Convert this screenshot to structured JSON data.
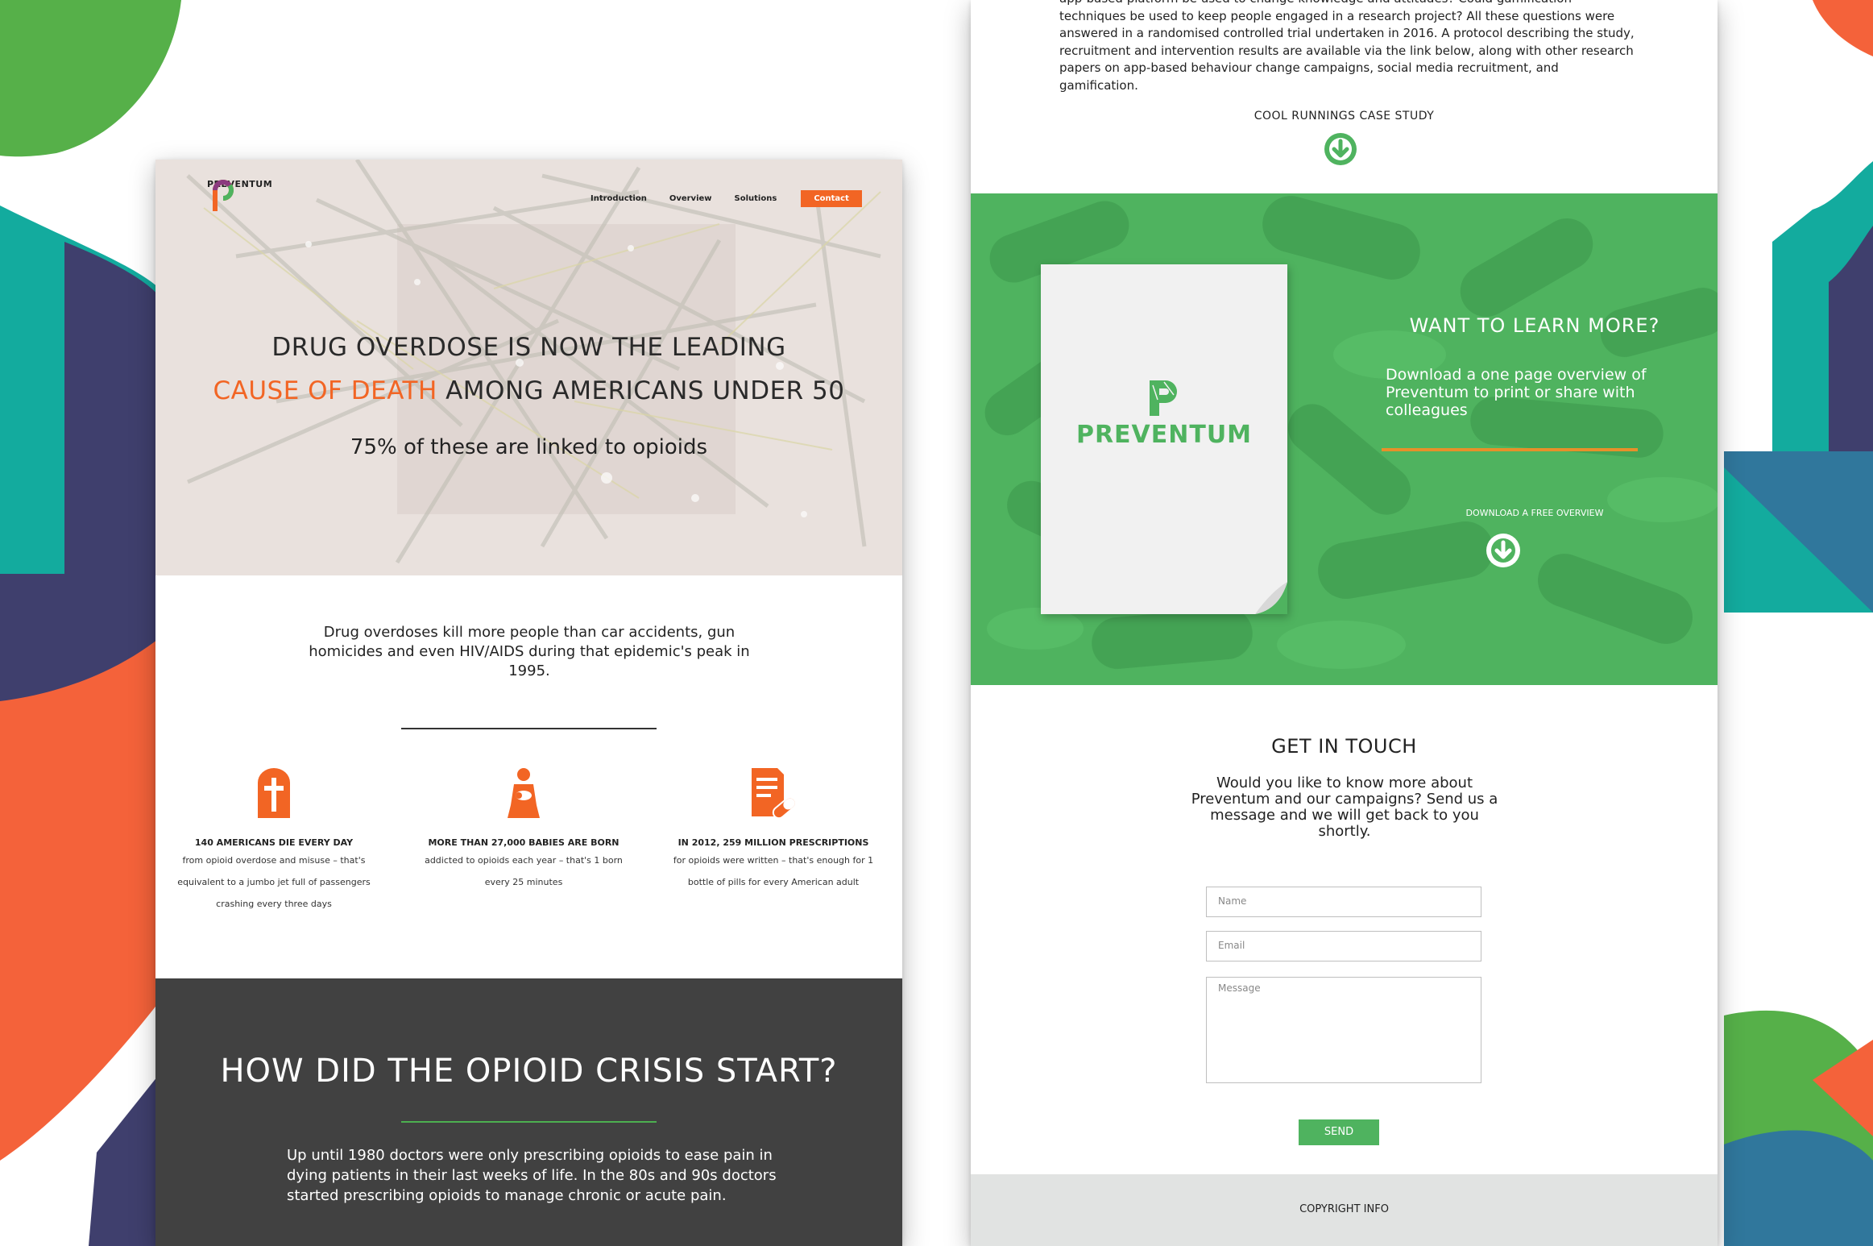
{
  "colors": {
    "accent_orange": "#f26524",
    "accent_green": "#4fb35f",
    "dark_section": "#414141",
    "bg_green": "#56b049",
    "bg_teal": "#13ab9e",
    "bg_navy": "#3f3f6d",
    "bg_blue": "#30779c"
  },
  "brand": {
    "name": "PREVENTUM",
    "logo_icon": "p-swirl-logo-icon"
  },
  "nav": {
    "items": [
      "Introduction",
      "Overview",
      "Solutions"
    ],
    "contact_label": "Contact"
  },
  "hero": {
    "line1": "DRUG OVERDOSE IS NOW THE LEADING",
    "line2_accent": "CAUSE OF DEATH",
    "line2_rest": " AMONG AMERICANS UNDER 50",
    "subtitle": "75% of these are linked to opioids"
  },
  "intro": {
    "text": "Drug overdoses kill more people than car accidents, gun homicides and even HIV/AIDS during that epidemic's peak in 1995."
  },
  "stats": [
    {
      "icon": "tombstone-cross-icon",
      "title": "140 AMERICANS DIE EVERY DAY",
      "body": "from opioid overdose and misuse – that's equivalent to a jumbo jet full of passengers crashing every three days"
    },
    {
      "icon": "mother-baby-icon",
      "title": "MORE THAN 27,000 BABIES ARE BORN",
      "body": "addicted to opioids each year – that's 1 born every 25 minutes"
    },
    {
      "icon": "prescription-pill-icon",
      "title": "IN 2012, 259 MILLION PRESCRIPTIONS",
      "body": "for opioids were written – that's enough for 1 bottle of pills for every American adult"
    }
  ],
  "crisis": {
    "title": "HOW DID THE OPIOID CRISIS START?",
    "body": "Up until 1980 doctors were only prescribing opioids to ease pain in dying patients in their last weeks of life. In the 80s and 90s doctors started prescribing opioids to manage chronic or acute pain."
  },
  "research": {
    "paragraph": "app-based platform be used to change knowledge and attitudes? Could gamification techniques be used to keep people engaged in a research project? All these questions were answered in a randomised controlled trial undertaken in 2016. A protocol describing the study, recruitment and intervention results are available via the link below, along with other research papers on app-based behaviour change campaigns, social media recruitment, and gamification.",
    "case_study_label": "COOL RUNNINGS CASE STUDY"
  },
  "learn_more": {
    "title": "WANT TO LEARN MORE?",
    "body": "Download a one page overview of Preventum to print or share with colleagues",
    "download_label": "DOWNLOAD A FREE OVERVIEW",
    "paper_brand": "PREVENTUM"
  },
  "contact_form": {
    "title": "GET IN TOUCH",
    "body": "Would you like to know more about Preventum and our campaigns? Send us a message and we will get back to you shortly.",
    "name_placeholder": "Name",
    "email_placeholder": "Email",
    "message_placeholder": "Message",
    "send_label": "SEND"
  },
  "footer": {
    "copyright": "COPYRIGHT INFO"
  }
}
